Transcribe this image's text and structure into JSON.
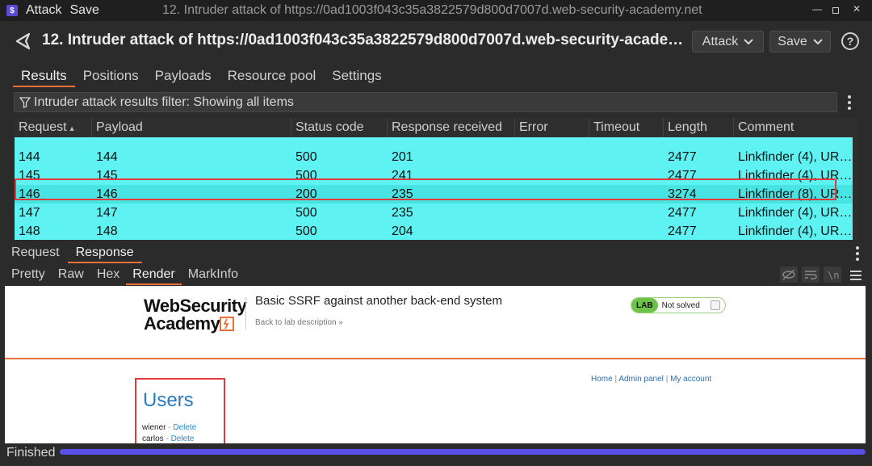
{
  "window": {
    "menu": [
      "Attack",
      "Save"
    ],
    "title": "12. Intruder attack of https://0ad1003f043c35a3822579d800d7007d.web-security-academy.net"
  },
  "header": {
    "title": "12. Intruder attack of https://0ad1003f043c35a3822579d800d7007d.web-security-acade…",
    "attack_label": "Attack",
    "save_label": "Save",
    "help_glyph": "?"
  },
  "main_tabs": [
    "Results",
    "Positions",
    "Payloads",
    "Resource pool",
    "Settings"
  ],
  "filter": {
    "text": "Intruder attack results filter: Showing all items"
  },
  "table": {
    "columns": [
      "Request",
      "Payload",
      "Status code",
      "Response received",
      "Error",
      "Timeout",
      "Length",
      "Comment"
    ],
    "rows": [
      {
        "request": "144",
        "payload": "144",
        "status": "500",
        "received": "201",
        "error": "",
        "timeout": "",
        "length": "2477",
        "comment": "Linkfinder (4), UR…"
      },
      {
        "request": "145",
        "payload": "145",
        "status": "500",
        "received": "241",
        "error": "",
        "timeout": "",
        "length": "2477",
        "comment": "Linkfinder (4), UR…"
      },
      {
        "request": "146",
        "payload": "146",
        "status": "200",
        "received": "235",
        "error": "",
        "timeout": "",
        "length": "3274",
        "comment": "Linkfinder (8), UR…"
      },
      {
        "request": "147",
        "payload": "147",
        "status": "500",
        "received": "235",
        "error": "",
        "timeout": "",
        "length": "2477",
        "comment": "Linkfinder (4), UR…"
      },
      {
        "request": "148",
        "payload": "148",
        "status": "500",
        "received": "204",
        "error": "",
        "timeout": "",
        "length": "2477",
        "comment": "Linkfinder (4), UR…"
      }
    ],
    "selected_request": "146"
  },
  "message_tabs": [
    "Request",
    "Response"
  ],
  "view_tabs": [
    "Pretty",
    "Raw",
    "Hex",
    "Render",
    "MarkInfo"
  ],
  "render": {
    "logo_line1": "WebSecurity",
    "logo_line2": "Academy",
    "lab_title": "Basic SSRF against another back-end system",
    "back_link": "Back to lab description »",
    "lab_badge": "LAB",
    "lab_status": "Not solved",
    "nav": {
      "home": "Home",
      "admin": "Admin panel",
      "account": "My account",
      "separator": "|"
    },
    "heading": "Users",
    "users": [
      {
        "name": "wiener",
        "sep": " - ",
        "action": "Delete"
      },
      {
        "name": "carlos",
        "sep": " - ",
        "action": "Delete"
      }
    ]
  },
  "status": {
    "text": "Finished",
    "progress": 1.0
  },
  "colors": {
    "accent": "#e8703a",
    "row_bg": "#5ef2f2",
    "progress": "#5a4ee8",
    "highlight": "#e03a3a"
  }
}
